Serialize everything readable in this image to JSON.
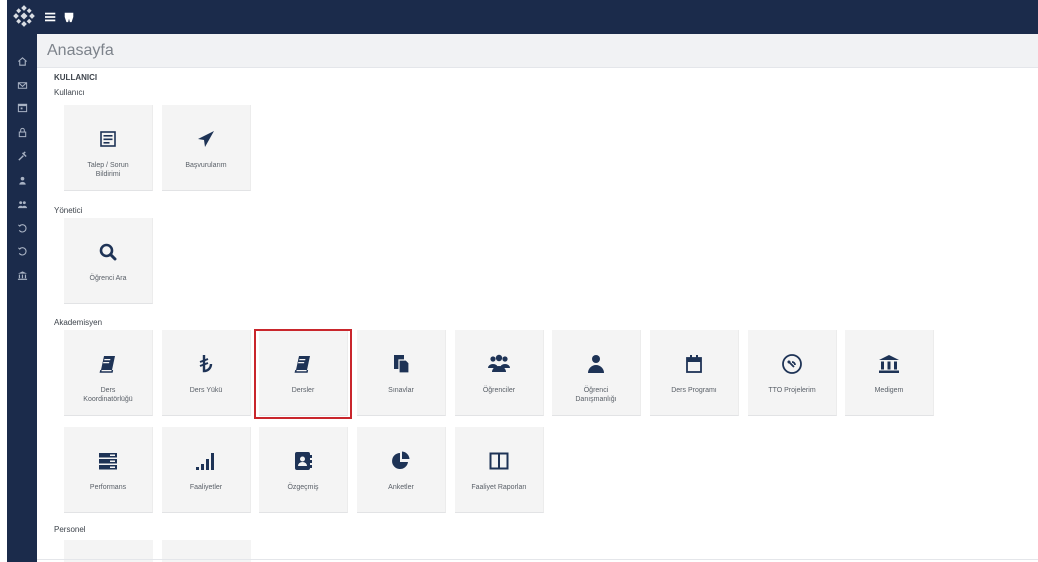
{
  "header": {
    "logo_icon": "university-logo-icon",
    "menu_icon": "hamburger-menu-icon",
    "secondary_icon": "tooth-icon",
    "bg_color": "#1b2b4b"
  },
  "sidebar": {
    "items": [
      {
        "name": "home-icon"
      },
      {
        "name": "mail-icon"
      },
      {
        "name": "calendar-icon"
      },
      {
        "name": "lock-icon"
      },
      {
        "name": "tools-icon"
      },
      {
        "name": "user-icon"
      },
      {
        "name": "users-icon"
      },
      {
        "name": "history-icon"
      },
      {
        "name": "history-alt-icon"
      },
      {
        "name": "bank-icon"
      }
    ]
  },
  "page": {
    "title": "Anasayfa",
    "section_title": "KULLANICI"
  },
  "groups": {
    "kullanici": {
      "label": "Kullanıcı",
      "tiles": [
        {
          "icon": "form-list-icon",
          "label_line1": "Talep / Sorun",
          "label_line2": "Bildirimi"
        },
        {
          "icon": "paper-plane-icon",
          "label_line1": "Başvurularım",
          "label_line2": ""
        }
      ]
    },
    "yonetici": {
      "label": "Yönetici",
      "tiles": [
        {
          "icon": "search-icon",
          "label_line1": "Öğrenci Ara",
          "label_line2": ""
        }
      ]
    },
    "akademisyen": {
      "label": "Akademisyen",
      "tiles": [
        {
          "icon": "book-icon",
          "label_line1": "Ders",
          "label_line2": "Koordinatörlüğü"
        },
        {
          "icon": "lira-icon",
          "label_line1": "Ders Yükü",
          "label_line2": ""
        },
        {
          "icon": "book-icon",
          "label_line1": "Dersler",
          "label_line2": ""
        },
        {
          "icon": "documents-icon",
          "label_line1": "Sınavlar",
          "label_line2": ""
        },
        {
          "icon": "users-icon",
          "label_line1": "Öğrenciler",
          "label_line2": ""
        },
        {
          "icon": "user-icon",
          "label_line1": "Öğrenci",
          "label_line2": "Danışmanlığı"
        },
        {
          "icon": "calendar-icon",
          "label_line1": "Ders Programı",
          "label_line2": ""
        },
        {
          "icon": "satellite-icon",
          "label_line1": "TTO Projelerim",
          "label_line2": ""
        },
        {
          "icon": "bank-icon",
          "label_line1": "Medigem",
          "label_line2": ""
        },
        {
          "icon": "server-icon",
          "label_line1": "Performans",
          "label_line2": ""
        },
        {
          "icon": "signal-bars-icon",
          "label_line1": "Faaliyetler",
          "label_line2": ""
        },
        {
          "icon": "contact-book-icon",
          "label_line1": "Özgeçmiş",
          "label_line2": ""
        },
        {
          "icon": "pie-chart-icon",
          "label_line1": "Anketler",
          "label_line2": ""
        },
        {
          "icon": "columns-icon",
          "label_line1": "Faaliyet Raporları",
          "label_line2": ""
        }
      ]
    },
    "personel": {
      "label": "Personel"
    }
  },
  "highlight_color": "#c9262c",
  "accent_color": "#1e3356"
}
